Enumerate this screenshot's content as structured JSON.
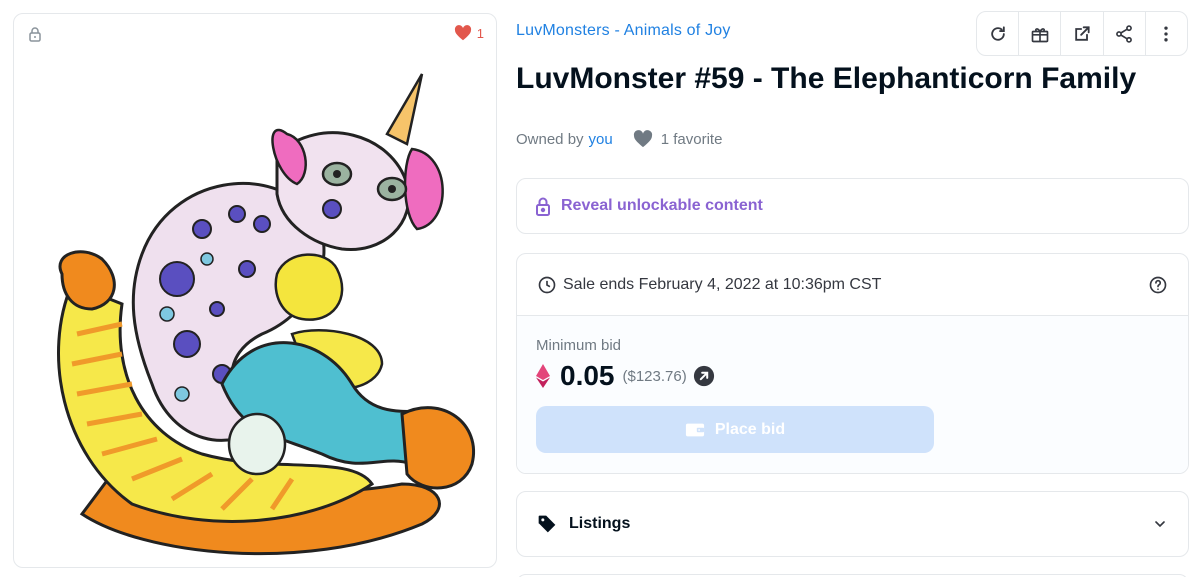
{
  "image_card": {
    "favorite_count": "1"
  },
  "collection": {
    "name": "LuvMonsters - Animals of Joy"
  },
  "toolbar": {
    "buttons": [
      "refresh-icon",
      "gift-icon",
      "external-link-icon",
      "share-icon",
      "more-vertical-icon"
    ]
  },
  "asset": {
    "title": "LuvMonster #59 - The Elephanticorn Family",
    "owned_by_label": "Owned by",
    "owner": "you",
    "favorites": "1 favorite"
  },
  "unlockable": {
    "label": "Reveal unlockable content"
  },
  "sale": {
    "ends_text": "Sale ends February 4, 2022 at 10:36pm CST",
    "min_bid_label": "Minimum bid",
    "amount": "0.05",
    "usd": "($123.76)",
    "place_bid_label": "Place bid"
  },
  "listings": {
    "label": "Listings"
  },
  "colors": {
    "link_blue": "#2081e2",
    "unlock_purple": "#8a63d2",
    "heart_red": "#e2574c",
    "bid_button": "#cfe2fb",
    "eth_pink": "#e3457a"
  }
}
